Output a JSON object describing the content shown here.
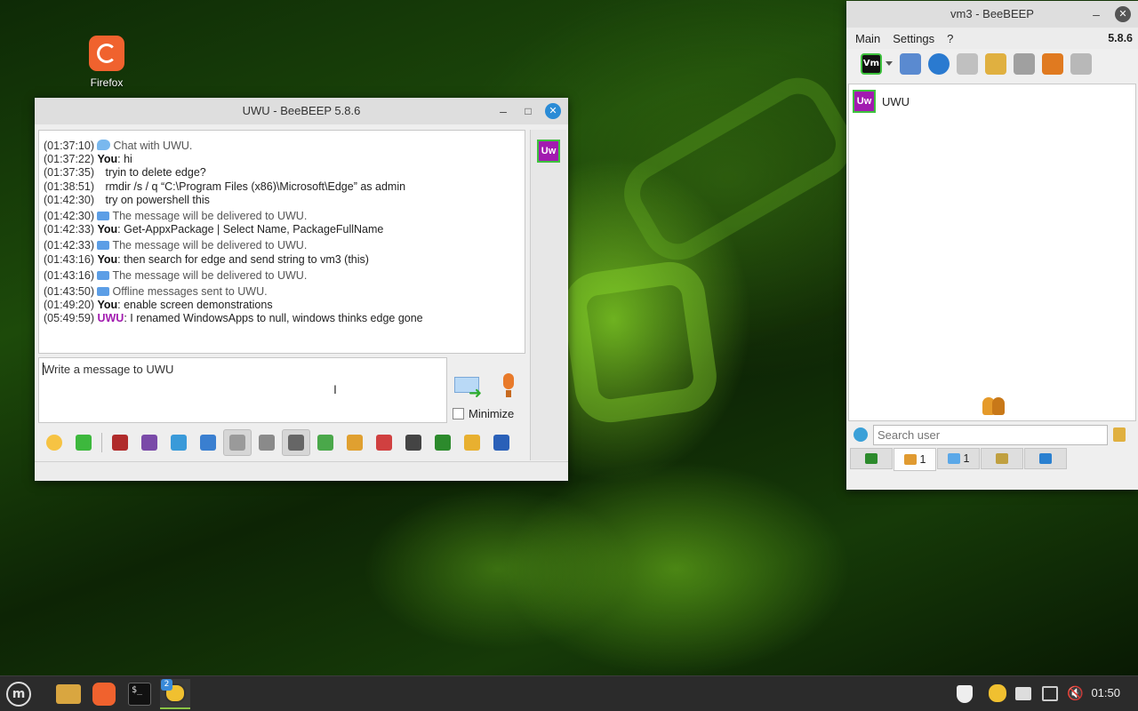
{
  "desktop": {
    "icons": [
      {
        "label": "Firefox"
      }
    ]
  },
  "chat_window": {
    "title": "UWU - BeeBEEP 5.8.6",
    "avatar_text": "Uw",
    "messages": [
      {
        "time": "(01:37:10)",
        "kind": "system",
        "icon": "chat-bubble-icon",
        "text": "Chat with UWU."
      },
      {
        "time": "(01:37:22)",
        "kind": "msg",
        "sender": "You",
        "text": ": hi"
      },
      {
        "time": "(01:37:35)",
        "kind": "cont",
        "text": "tryin to delete edge?"
      },
      {
        "time": "(01:38:51)",
        "kind": "cont",
        "text": "rmdir /s / q “C:\\Program Files (x86)\\Microsoft\\Edge” as admin"
      },
      {
        "time": "(01:42:30)",
        "kind": "cont",
        "text": "try on powershell this"
      },
      {
        "time": "(01:42:30)",
        "kind": "system",
        "icon": "envelope-icon",
        "text": "The message will be delivered to UWU."
      },
      {
        "time": "(01:42:33)",
        "kind": "msg",
        "sender": "You",
        "text": ": Get-AppxPackage | Select Name, PackageFullName"
      },
      {
        "time": "(01:42:33)",
        "kind": "system",
        "icon": "envelope-icon",
        "text": "The message will be delivered to UWU."
      },
      {
        "time": "(01:43:16)",
        "kind": "msg",
        "sender": "You",
        "text": ": then search for edge and send string to vm3 (this)"
      },
      {
        "time": "(01:43:16)",
        "kind": "system",
        "icon": "envelope-icon",
        "text": "The message will be delivered to UWU."
      },
      {
        "time": "(01:43:50)",
        "kind": "system",
        "icon": "envelope-icon",
        "text": "Offline messages sent to UWU."
      },
      {
        "time": "(01:49:20)",
        "kind": "msg",
        "sender": "You",
        "text": ": enable screen demonstrations"
      },
      {
        "time": "(05:49:59)",
        "kind": "msg-them",
        "sender": "UWU",
        "text": ": I renamed WindowsApps to null, windows thinks edge gone"
      }
    ],
    "composer_placeholder": "Write a message to UWU",
    "minimize_label": "Minimize",
    "minimize_checked": false,
    "toolbar_icons": [
      {
        "name": "emoticon-icon",
        "color": "#f6c343"
      },
      {
        "name": "send-file-icon",
        "color": "#3db83d"
      },
      {
        "sep": true
      },
      {
        "name": "font-icon",
        "color": "#b02b2b"
      },
      {
        "name": "color-icon",
        "color": "#7a4aa8"
      },
      {
        "name": "filter-icon",
        "color": "#3a9ad9"
      },
      {
        "name": "settings-icon",
        "color": "#3a7fd0"
      },
      {
        "name": "save-chat-icon",
        "color": "#9a9a9a",
        "pressed": true
      },
      {
        "name": "spell-check-icon",
        "color": "#8a8a8a"
      },
      {
        "name": "sound-icon",
        "color": "#666666",
        "pressed": true
      },
      {
        "name": "export-icon",
        "color": "#4aa84a"
      },
      {
        "name": "folder-arrow-icon",
        "color": "#e0a030"
      },
      {
        "name": "html-icon",
        "color": "#d04040"
      },
      {
        "name": "screenshot-icon",
        "color": "#444444"
      },
      {
        "name": "screen-share-icon",
        "color": "#2c8a2c"
      },
      {
        "name": "notes-icon",
        "color": "#e8b030"
      },
      {
        "name": "save-icon",
        "color": "#2a60b8"
      }
    ]
  },
  "main_window": {
    "title": "vm3 - BeeBEEP",
    "menu": [
      "Main",
      "Settings",
      "?"
    ],
    "version": "5.8.6",
    "toolbar_icons": [
      {
        "name": "my-avatar-icon",
        "color": "#111111",
        "label": "Vm"
      },
      {
        "name": "status-dropdown-icon",
        "color": "#555555"
      },
      {
        "name": "edit-profile-icon",
        "color": "#5a8ad0"
      },
      {
        "name": "network-icon",
        "color": "#2a7ad0"
      },
      {
        "name": "clipboard-icon",
        "color": "#c0c0c0"
      },
      {
        "name": "pencil-icon",
        "color": "#e0b040"
      },
      {
        "name": "tools-icon",
        "color": "#a0a0a0"
      },
      {
        "name": "upload-icon",
        "color": "#e07a20"
      },
      {
        "name": "trash-icon",
        "color": "#b8b8b8"
      }
    ],
    "users": [
      {
        "avatar": "Uw",
        "name": "UWU"
      }
    ],
    "search_placeholder": "Search user",
    "tabs": [
      {
        "name": "tab-home",
        "icon_color": "#2c8a2c",
        "count": ""
      },
      {
        "name": "tab-users",
        "icon_color": "#e09a30",
        "count": "1",
        "active": true
      },
      {
        "name": "tab-chats",
        "icon_color": "#5ba8e8",
        "count": "1"
      },
      {
        "name": "tab-groups",
        "icon_color": "#c0a040",
        "count": ""
      },
      {
        "name": "tab-files",
        "icon_color": "#2a80d0",
        "count": ""
      }
    ]
  },
  "taskbar": {
    "clock": "01:50",
    "badge": "2"
  }
}
